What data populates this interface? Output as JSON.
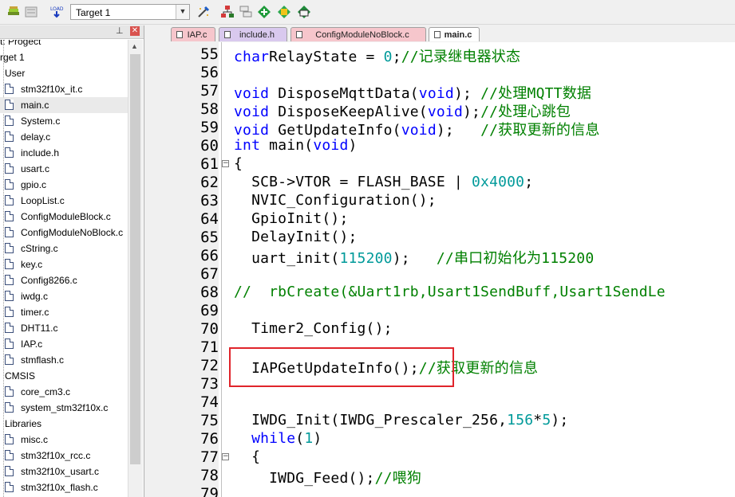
{
  "toolbar": {
    "target": "Target 1",
    "icons": [
      "translate-icon",
      "build-icon",
      "load-icon",
      "target-options-icon",
      "manage-project-icon",
      "file-extensions-icon",
      "select-packs-icon",
      "pack-installer-icon",
      "manage-rte-icon"
    ]
  },
  "project_panel": {
    "tree": [
      {
        "label": "t: Progect",
        "indent": 0,
        "type": "root"
      },
      {
        "label": "rget 1",
        "indent": 0,
        "type": "group"
      },
      {
        "label": "User",
        "indent": 6,
        "type": "group"
      },
      {
        "label": "stm32f10x_it.c",
        "indent": 6,
        "type": "file"
      },
      {
        "label": "main.c",
        "indent": 6,
        "type": "file",
        "selected": true
      },
      {
        "label": "System.c",
        "indent": 6,
        "type": "file"
      },
      {
        "label": "delay.c",
        "indent": 6,
        "type": "file"
      },
      {
        "label": "include.h",
        "indent": 6,
        "type": "file"
      },
      {
        "label": "usart.c",
        "indent": 6,
        "type": "file"
      },
      {
        "label": "gpio.c",
        "indent": 6,
        "type": "file"
      },
      {
        "label": "LoopList.c",
        "indent": 6,
        "type": "file"
      },
      {
        "label": "ConfigModuleBlock.c",
        "indent": 6,
        "type": "file"
      },
      {
        "label": "ConfigModuleNoBlock.c",
        "indent": 6,
        "type": "file"
      },
      {
        "label": "cString.c",
        "indent": 6,
        "type": "file"
      },
      {
        "label": "key.c",
        "indent": 6,
        "type": "file"
      },
      {
        "label": "Config8266.c",
        "indent": 6,
        "type": "file"
      },
      {
        "label": "iwdg.c",
        "indent": 6,
        "type": "file"
      },
      {
        "label": "timer.c",
        "indent": 6,
        "type": "file"
      },
      {
        "label": "DHT11.c",
        "indent": 6,
        "type": "file"
      },
      {
        "label": "IAP.c",
        "indent": 6,
        "type": "file"
      },
      {
        "label": "stmflash.c",
        "indent": 6,
        "type": "file"
      },
      {
        "label": "CMSIS",
        "indent": 6,
        "type": "group"
      },
      {
        "label": "core_cm3.c",
        "indent": 6,
        "type": "file"
      },
      {
        "label": "system_stm32f10x.c",
        "indent": 6,
        "type": "file"
      },
      {
        "label": "Libraries",
        "indent": 6,
        "type": "group"
      },
      {
        "label": "misc.c",
        "indent": 6,
        "type": "file"
      },
      {
        "label": "stm32f10x_rcc.c",
        "indent": 6,
        "type": "file"
      },
      {
        "label": "stm32f10x_usart.c",
        "indent": 6,
        "type": "file"
      },
      {
        "label": "stm32f10x_flash.c",
        "indent": 6,
        "type": "file"
      }
    ]
  },
  "tabs": [
    {
      "label": "IAP.c",
      "color": "#f6c6cc",
      "active": false
    },
    {
      "label": "include.h",
      "color": "#d9c9ee",
      "active": false
    },
    {
      "label": "ConfigModuleNoBlock.c",
      "color": "#f6c6cc",
      "active": false
    },
    {
      "label": "main.c",
      "color": "#ffffff",
      "active": true
    }
  ],
  "editor": {
    "lines": [
      {
        "n": "55",
        "fold": "",
        "segs": [
          [
            "kw",
            "char"
          ],
          [
            "",
            "RelayState = "
          ],
          [
            "num",
            "0"
          ],
          [
            "",
            ";"
          ],
          [
            "cm",
            "//记录继电器状态"
          ]
        ]
      },
      {
        "n": "56",
        "fold": "",
        "segs": []
      },
      {
        "n": "57",
        "fold": "",
        "segs": [
          [
            "kw",
            "void"
          ],
          [
            "",
            " DisposeMqttData("
          ],
          [
            "kw",
            "void"
          ],
          [
            "",
            "); "
          ],
          [
            "cm",
            "//处理MQTT数据"
          ]
        ]
      },
      {
        "n": "58",
        "fold": "",
        "segs": [
          [
            "kw",
            "void"
          ],
          [
            "",
            " DisposeKeepAlive("
          ],
          [
            "kw",
            "void"
          ],
          [
            "",
            ");"
          ],
          [
            "cm",
            "//处理心跳包"
          ]
        ]
      },
      {
        "n": "59",
        "fold": "",
        "segs": [
          [
            "kw",
            "void"
          ],
          [
            "",
            " GetUpdateInfo("
          ],
          [
            "kw",
            "void"
          ],
          [
            "",
            ");   "
          ],
          [
            "cm",
            "//获取更新的信息"
          ]
        ]
      },
      {
        "n": "60",
        "fold": "",
        "segs": [
          [
            "kw",
            "int"
          ],
          [
            "",
            " main("
          ],
          [
            "kw",
            "void"
          ],
          [
            "",
            ")"
          ]
        ]
      },
      {
        "n": "61",
        "fold": "⊟",
        "segs": [
          [
            "",
            "{"
          ]
        ]
      },
      {
        "n": "62",
        "fold": "",
        "segs": [
          [
            "",
            "  SCB->VTOR = FLASH_BASE | "
          ],
          [
            "num",
            "0x4000"
          ],
          [
            "",
            ";"
          ]
        ]
      },
      {
        "n": "63",
        "fold": "",
        "segs": [
          [
            "",
            "  NVIC_Configuration();"
          ]
        ]
      },
      {
        "n": "64",
        "fold": "",
        "segs": [
          [
            "",
            "  GpioInit();"
          ]
        ]
      },
      {
        "n": "65",
        "fold": "",
        "segs": [
          [
            "",
            "  DelayInit();"
          ]
        ]
      },
      {
        "n": "66",
        "fold": "",
        "segs": [
          [
            "",
            "  uart_init("
          ],
          [
            "num",
            "115200"
          ],
          [
            "",
            "); "
          ],
          [
            "cm",
            "  //串口初始化为115200"
          ]
        ]
      },
      {
        "n": "67",
        "fold": "",
        "segs": []
      },
      {
        "n": "68",
        "fold": "",
        "segs": [
          [
            "cm",
            "//  rbCreate(&Uart1rb,Usart1SendBuff,Usart1SendLe"
          ]
        ]
      },
      {
        "n": "69",
        "fold": "",
        "segs": []
      },
      {
        "n": "70",
        "fold": "",
        "segs": [
          [
            "",
            "  Timer2_Config();"
          ]
        ]
      },
      {
        "n": "71",
        "fold": "",
        "segs": []
      },
      {
        "n": "72",
        "fold": "",
        "segs": [
          [
            "",
            "  IAPGetUpdateInfo();"
          ],
          [
            "cm",
            "//获取更新的信息"
          ]
        ]
      },
      {
        "n": "73",
        "fold": "",
        "segs": []
      },
      {
        "n": "74",
        "fold": "",
        "segs": []
      },
      {
        "n": "75",
        "fold": "",
        "segs": [
          [
            "",
            "  IWDG_Init(IWDG_Prescaler_256,"
          ],
          [
            "num",
            "156"
          ],
          [
            "",
            "*"
          ],
          [
            "num",
            "5"
          ],
          [
            "",
            ");"
          ]
        ]
      },
      {
        "n": "76",
        "fold": "",
        "segs": [
          [
            "",
            "  "
          ],
          [
            "kw",
            "while"
          ],
          [
            "",
            "("
          ],
          [
            "num",
            "1"
          ],
          [
            "",
            ")"
          ]
        ]
      },
      {
        "n": "77",
        "fold": "⊟",
        "segs": [
          [
            "",
            "  {"
          ]
        ]
      },
      {
        "n": "78",
        "fold": "",
        "segs": [
          [
            "",
            "    IWDG_Feed();"
          ],
          [
            "cm",
            "//喂狗"
          ]
        ]
      },
      {
        "n": "79",
        "fold": "",
        "segs": []
      }
    ]
  }
}
